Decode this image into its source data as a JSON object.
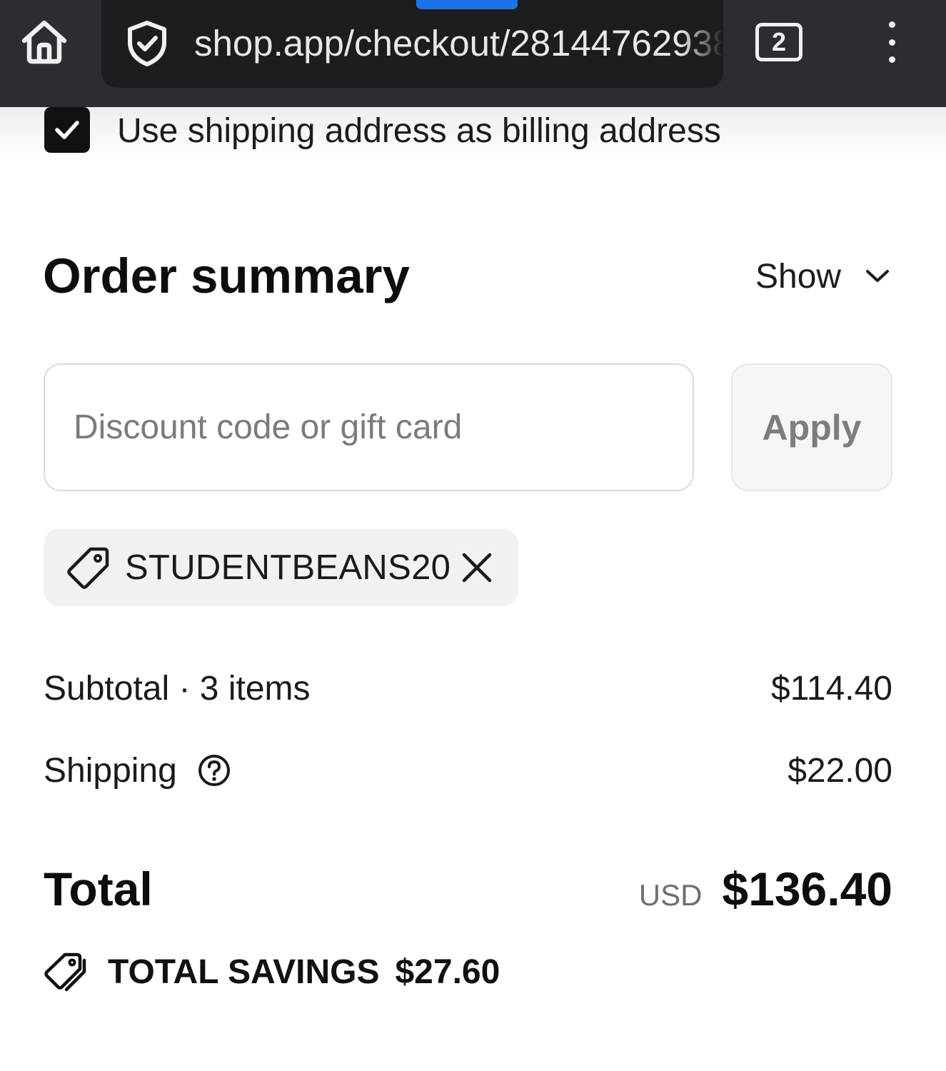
{
  "browser": {
    "url": "shop.app/checkout/28144762938",
    "tab_count": "2"
  },
  "billing": {
    "same_as_shipping_label": "Use shipping address as billing address",
    "same_as_shipping_checked": true
  },
  "order_summary": {
    "title": "Order summary",
    "toggle_label": "Show"
  },
  "discount": {
    "placeholder": "Discount code or gift card",
    "value": "",
    "apply_label": "Apply",
    "applied_code": "STUDENTBEANS20"
  },
  "totals": {
    "subtotal_label": "Subtotal · 3 items",
    "subtotal_value": "$114.40",
    "shipping_label": "Shipping",
    "shipping_value": "$22.00",
    "total_label": "Total",
    "currency": "USD",
    "total_value": "$136.40",
    "savings_label": "TOTAL SAVINGS",
    "savings_value": "$27.60"
  },
  "colors": {
    "browser_bar": "#2b2d33",
    "url_box": "#1c1d21",
    "progress": "#1a73e8",
    "text_primary": "#111111",
    "text_muted": "#7b7b7b"
  },
  "icons": [
    "home-icon",
    "shield-check-icon",
    "tabs-icon",
    "more-vert-icon",
    "checkmark-icon",
    "chevron-down-icon",
    "tag-icon",
    "close-icon",
    "help-circle-icon",
    "savings-tags-icon"
  ]
}
